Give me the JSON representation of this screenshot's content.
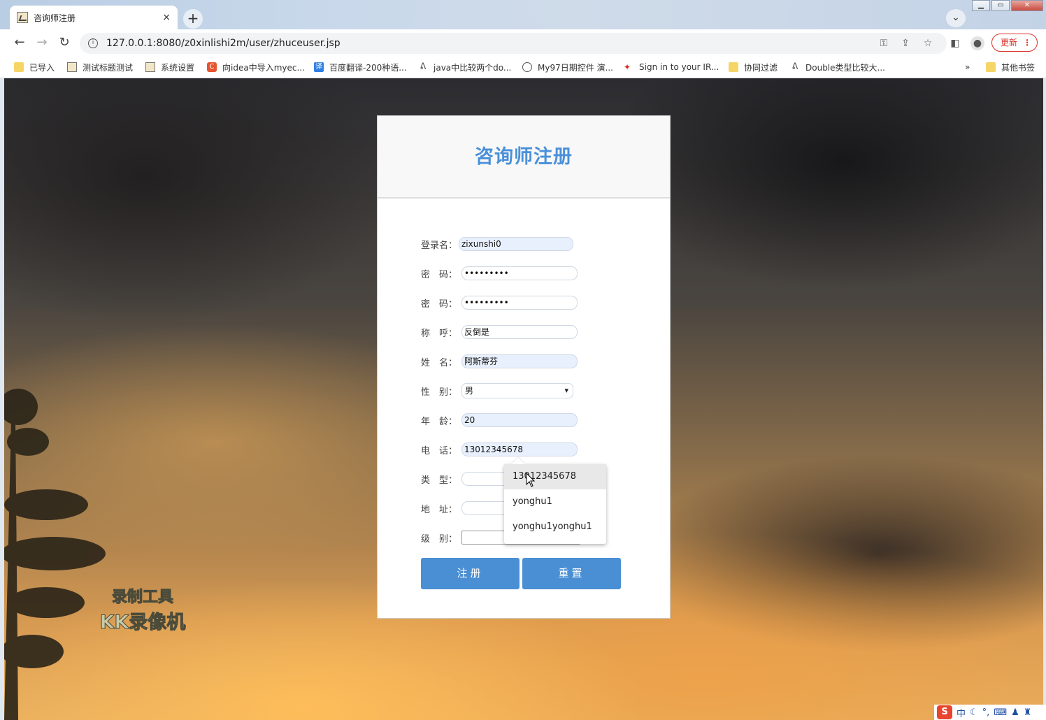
{
  "browser": {
    "tab_title": "咨询师注册",
    "tab_close": "×",
    "new_tab": "+",
    "url": "127.0.0.1:8080/z0xinlishi2m/user/zhuceuser.jsp",
    "update_label": "更新",
    "bookmarks": [
      {
        "label": "已导入",
        "icon": "folder-icon"
      },
      {
        "label": "测试标题测试",
        "icon": "page-icon"
      },
      {
        "label": "系统设置",
        "icon": "page-icon"
      },
      {
        "label": "向idea中导入myec...",
        "icon": "c-icon"
      },
      {
        "label": "百度翻译-200种语...",
        "icon": "translate-icon"
      },
      {
        "label": "java中比较两个do...",
        "icon": "lambda-icon"
      },
      {
        "label": "My97日期控件 演...",
        "icon": "globe-icon"
      },
      {
        "label": "Sign in to your IR...",
        "icon": "maple-leaf-icon"
      },
      {
        "label": "协同过滤",
        "icon": "folder-icon"
      },
      {
        "label": "Double类型比较大...",
        "icon": "lambda-icon"
      }
    ],
    "more_bookmarks": "»",
    "other_bookmarks": "其他书签"
  },
  "form": {
    "title": "咨询师注册",
    "fields": [
      {
        "label": "登录名：",
        "value": "zixunshi0",
        "filled": true
      },
      {
        "label": "密　码：",
        "value": "•••••••••",
        "filled": false
      },
      {
        "label": "密　码：",
        "value": "•••••••••",
        "filled": false
      },
      {
        "label": "称　呼：",
        "value": "反倒是",
        "filled": false
      },
      {
        "label": "姓　名：",
        "value": "阿斯蒂芬",
        "filled": true
      },
      {
        "label": "性　别：",
        "value": "男",
        "type": "select"
      },
      {
        "label": "年　龄：",
        "value": "20",
        "filled": true
      },
      {
        "label": "电　话：",
        "value": "13012345678",
        "filled": true
      },
      {
        "label": "类　型：",
        "value": "",
        "filled": false
      },
      {
        "label": "地　址：",
        "value": "",
        "filled": false
      },
      {
        "label": "级　别：",
        "value": "",
        "filled": false
      }
    ],
    "submit_label": "注册",
    "reset_label": "重置"
  },
  "autocomplete": [
    "13012345678",
    "yonghu1",
    "yonghu1yonghu1"
  ],
  "watermark": {
    "line1": "录制工具",
    "line2": "KK录像机"
  },
  "ime": {
    "logo": "S",
    "mode": "中"
  },
  "colors": {
    "accent": "#4a8fd4",
    "title": "#4a90d9",
    "autofill": "#e8f0fe",
    "update": "#d93025"
  }
}
